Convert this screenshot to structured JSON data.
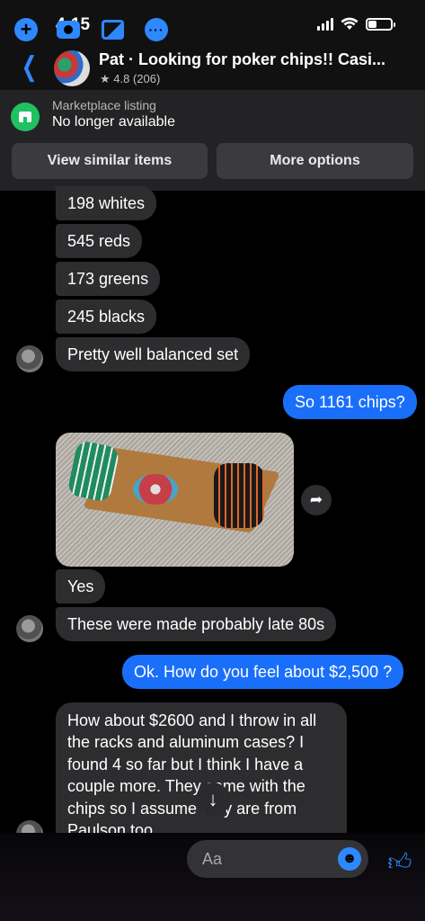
{
  "status_bar": {
    "time": "4:15"
  },
  "header": {
    "back_icon": "chevron-left-icon",
    "title": "Pat · Looking for poker chips!! Casi...",
    "rating": "★ 4.8 (206)"
  },
  "listing": {
    "label": "Marketplace listing",
    "status": "No longer available",
    "buttons": {
      "similar": "View similar items",
      "more": "More options"
    }
  },
  "messages": {
    "whites": "198 whites",
    "reds": "545 reds",
    "greens": "173 greens",
    "blacks": "245 blacks",
    "balanced": "Pretty well balanced set",
    "sent_chips": "So 1161 chips?",
    "yes": "Yes",
    "made": "These were made probably late 80s",
    "sent_offer": "Ok. How do you feel about $2,500 ?",
    "long": "How about $2600 and I throw in all the racks and aluminum cases?  I found 4 so far but I think I have a couple more. They come with the chips so I assume they are from Paulson too"
  },
  "composer": {
    "placeholder": "Aa",
    "icons": [
      "plus-icon",
      "camera-icon",
      "gallery-icon",
      "chat-bubble-icon",
      "emoji-icon",
      "thumbs-up-icon"
    ]
  },
  "colors": {
    "accent": "#2e88ff",
    "sent_bubble": "#1a6ffa",
    "received_bubble": "#2d2d2f",
    "marketplace_green": "#21c063"
  }
}
